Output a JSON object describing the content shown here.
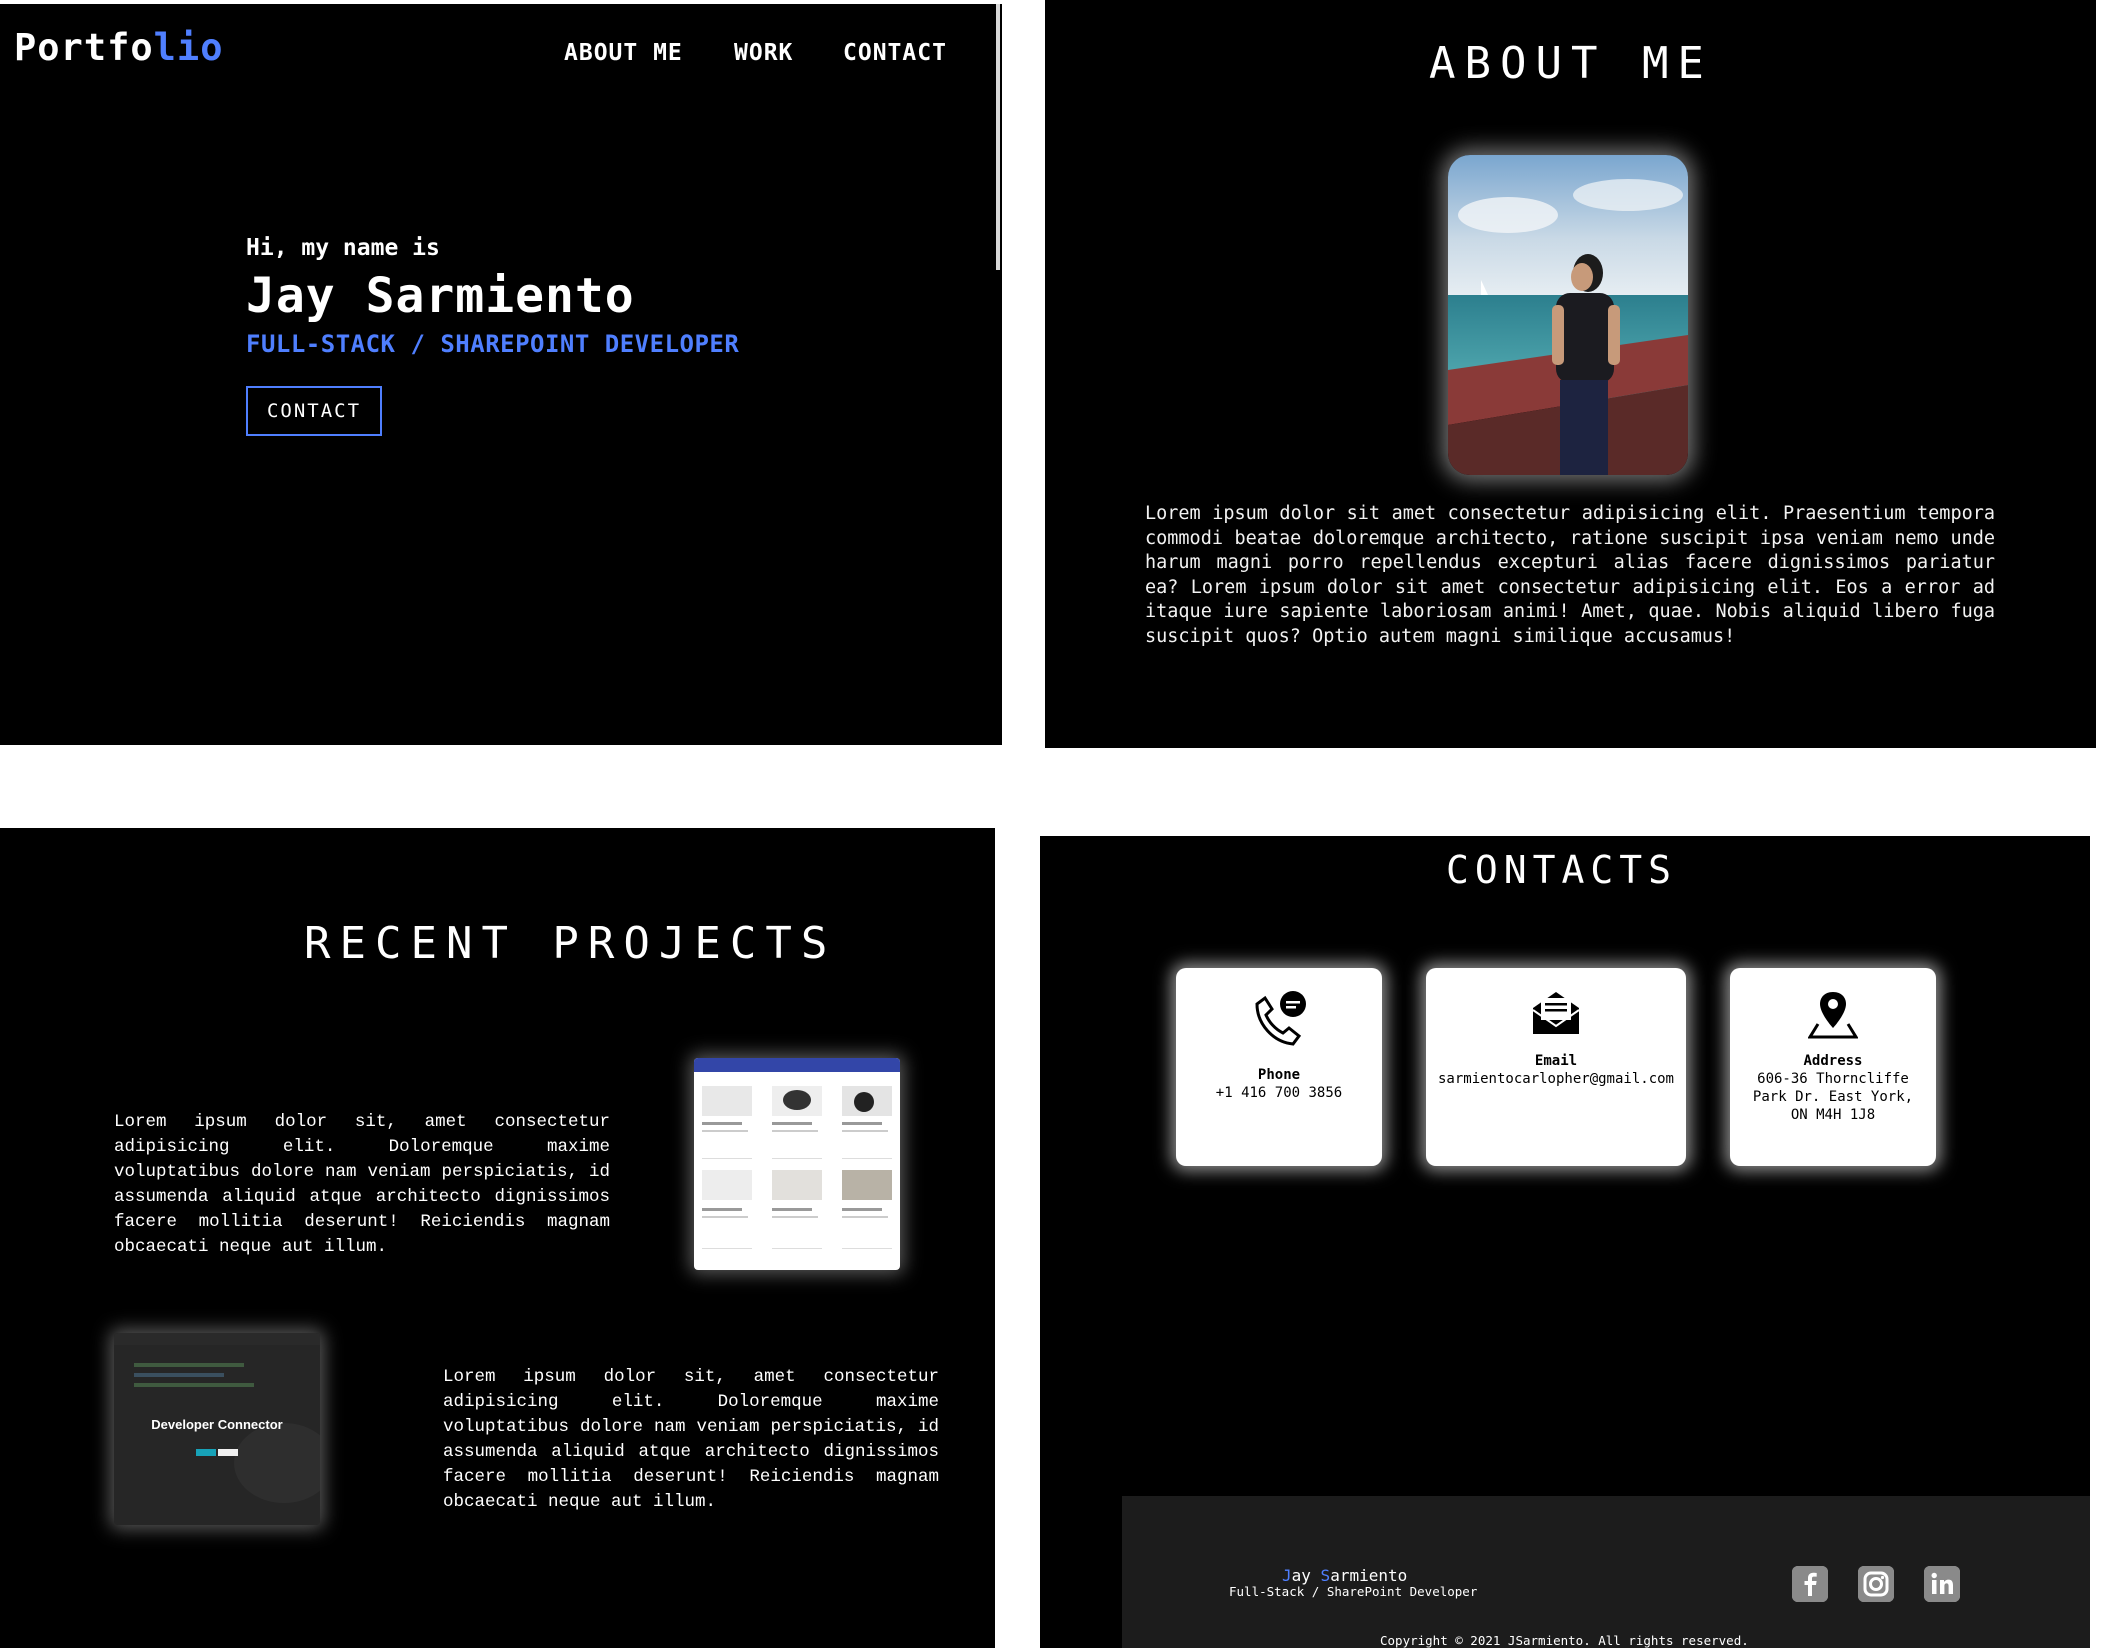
{
  "hero": {
    "logo_part1": "Portfo",
    "logo_part2": "lio",
    "nav": [
      "ABOUT ME",
      "WORK",
      "CONTACT"
    ],
    "greeting": "Hi, my name is",
    "name": "Jay Sarmiento",
    "role": "FULL-STACK / SHAREPOINT DEVELOPER",
    "button": "CONTACT"
  },
  "about": {
    "title": "ABOUT ME",
    "photo_icon": "profile-photo",
    "text": "Lorem ipsum dolor sit amet consectetur adipisicing elit. Praesentium tempora commodi beatae doloremque architecto, ratione suscipit ipsa veniam nemo unde harum magni porro repellendus excepturi alias facere dignissimos pariatur ea? Lorem ipsum dolor sit amet consectetur adipisicing elit. Eos a error ad itaque iure sapiente laboriosam animi! Amet, quae. Nobis aliquid libero fuga suscipit quos? Optio autem magni similique accusamus!"
  },
  "projects": {
    "title": "RECENT PROJECTS",
    "items": [
      {
        "text": "Lorem ipsum dolor sit, amet consectetur adipisicing elit. Doloremque maxime voluptatibus dolore nam veniam perspiciatis, id assumenda aliquid atque architecto dignissimos facere mollitia deserunt! Reiciendis magnam obcaecati neque aut illum."
      },
      {
        "text": "Lorem ipsum dolor sit, amet consectetur adipisicing elit. Doloremque maxime voluptatibus dolore nam veniam perspiciatis, id assumenda aliquid atque architecto dignissimos facere mollitia deserunt! Reiciendis magnam obcaecati neque aut illum.",
        "thumb_title": "Developer Connector"
      }
    ]
  },
  "contacts": {
    "title": "CONTACTS",
    "phone": {
      "label": "Phone",
      "value": "+1 416 700 3856",
      "icon": "phone-chat-icon"
    },
    "email": {
      "label": "Email",
      "value": "sarmientocarlopher@gmail.com",
      "icon": "envelope-icon"
    },
    "address": {
      "label": "Address",
      "line1": "606-36 Thorncliffe",
      "line2": "Park Dr. East York,",
      "line3": "ON M4H 1J8",
      "icon": "map-pin-icon"
    }
  },
  "footer": {
    "initial1": "J",
    "name1": "ay ",
    "initial2": "S",
    "name2": "armiento",
    "role": "Full-Stack / SharePoint Developer",
    "copyright": "Copyright © 2021 JSarmiento. All rights reserved.",
    "socials": [
      "facebook-icon",
      "instagram-icon",
      "linkedin-icon"
    ]
  },
  "colors": {
    "accent": "#4f7fff",
    "background": "#000000",
    "footer": "#1c1c1c"
  }
}
